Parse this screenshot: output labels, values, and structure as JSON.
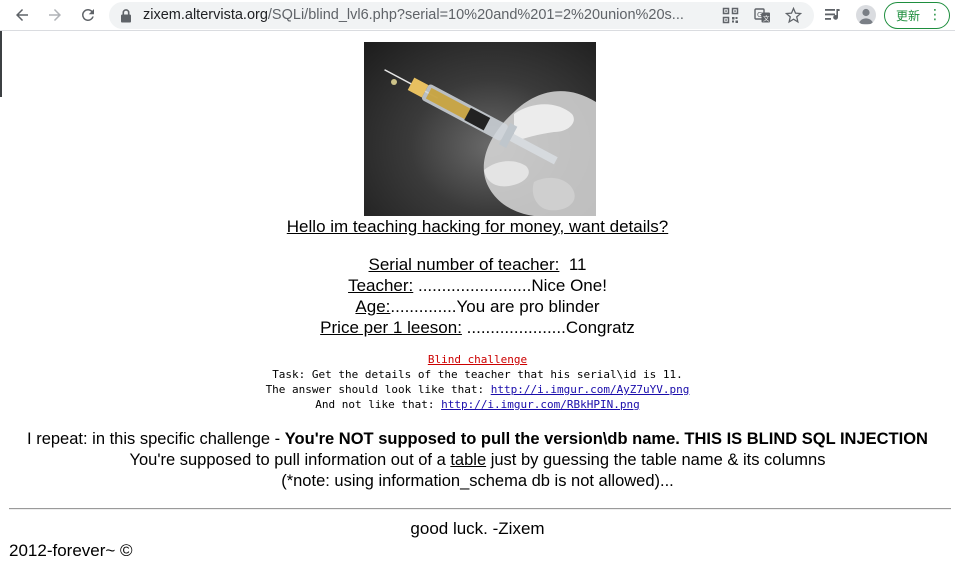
{
  "browser": {
    "url_host": "zixem.altervista.org",
    "url_path": "/SQLi/blind_lvl6.php?serial=10%20and%201=2%20union%20s...",
    "update_label": "更新",
    "icons": {
      "back": "back-arrow-icon",
      "forward": "forward-arrow-icon",
      "reload": "reload-icon",
      "lock": "lock-icon",
      "qr": "qr-code-icon",
      "translate": "translate-icon",
      "bookmark": "star-icon",
      "media": "media-controls-icon",
      "profile": "profile-icon",
      "menu": "more-vert-icon"
    },
    "colors": {
      "update_accent": "#1e8e3e"
    }
  },
  "page": {
    "hello_link": "Hello im teaching hacking for money, want details?",
    "info": {
      "serial_label": "Serial number of teacher:",
      "serial_value": "11",
      "teacher_label": "Teacher:",
      "teacher_value": " ........................Nice One!",
      "age_label": "Age:",
      "age_value": "..............You are pro blinder",
      "price_label": "Price per 1 leeson:",
      "price_value": " .....................Congratz"
    },
    "challenge": {
      "title_link": "Blind challenge",
      "task": "Task: Get the details of the teacher that his serial\\id is 11.",
      "answer_prefix": "The answer should look like that: ",
      "answer_link": "http://i.imgur.com/AyZ7uYV.png",
      "not_prefix": "And not like that: ",
      "not_link": "http://i.imgur.com/RBkHPIN.png"
    },
    "repeat": {
      "line1_normal": "I repeat: in this specific challenge - ",
      "line1_bold": "You're NOT supposed to pull the version\\db name. THIS IS BLIND SQL INJECTION",
      "line2_before": "You're supposed to pull information out of a ",
      "line2_link": "table",
      "line2_after": " just by guessing the table name & its columns",
      "line3": "(*note: using information_schema db is not allowed)..."
    },
    "footer": {
      "luck": "good luck. -Zixem",
      "copyright": "2012-forever~ ©"
    }
  }
}
